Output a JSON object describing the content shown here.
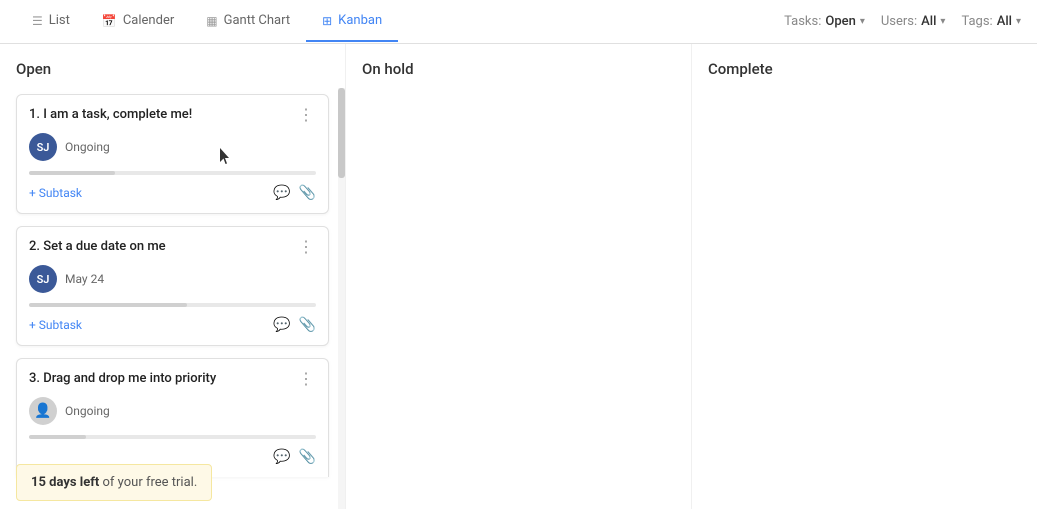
{
  "nav": {
    "tabs": [
      {
        "id": "list",
        "label": "List",
        "icon": "☰",
        "active": false
      },
      {
        "id": "calender",
        "label": "Calender",
        "icon": "📅",
        "active": false
      },
      {
        "id": "gantt",
        "label": "Gantt Chart",
        "icon": "📊",
        "active": false
      },
      {
        "id": "kanban",
        "label": "Kanban",
        "icon": "⊞",
        "active": true
      }
    ],
    "filters": {
      "tasks_label": "Tasks:",
      "tasks_value": "Open",
      "users_label": "Users:",
      "users_value": "All",
      "tags_label": "Tags:",
      "tags_value": "All"
    }
  },
  "columns": [
    {
      "id": "open",
      "header": "Open",
      "cards": [
        {
          "id": "card1",
          "title": "1. I am a task, complete me!",
          "avatar_initials": "SJ",
          "meta": "Ongoing",
          "progress": 30,
          "subtask_label": "+ Subtask"
        },
        {
          "id": "card2",
          "title": "2. Set a due date on me",
          "avatar_initials": "SJ",
          "meta": "May 24",
          "progress": 55,
          "subtask_label": "+ Subtask"
        },
        {
          "id": "card3",
          "title": "3. Drag and drop me into priority",
          "avatar_initials": null,
          "meta": "Ongoing",
          "progress": 20,
          "subtask_label": null
        }
      ]
    },
    {
      "id": "on-hold",
      "header": "On hold",
      "cards": []
    },
    {
      "id": "complete",
      "header": "Complete",
      "cards": []
    }
  ],
  "trial": {
    "text_bold": "15 days left",
    "text_rest": " of your free trial."
  },
  "icons": {
    "comment": "💬",
    "attachment": "📎",
    "menu_dots": "⋮"
  }
}
